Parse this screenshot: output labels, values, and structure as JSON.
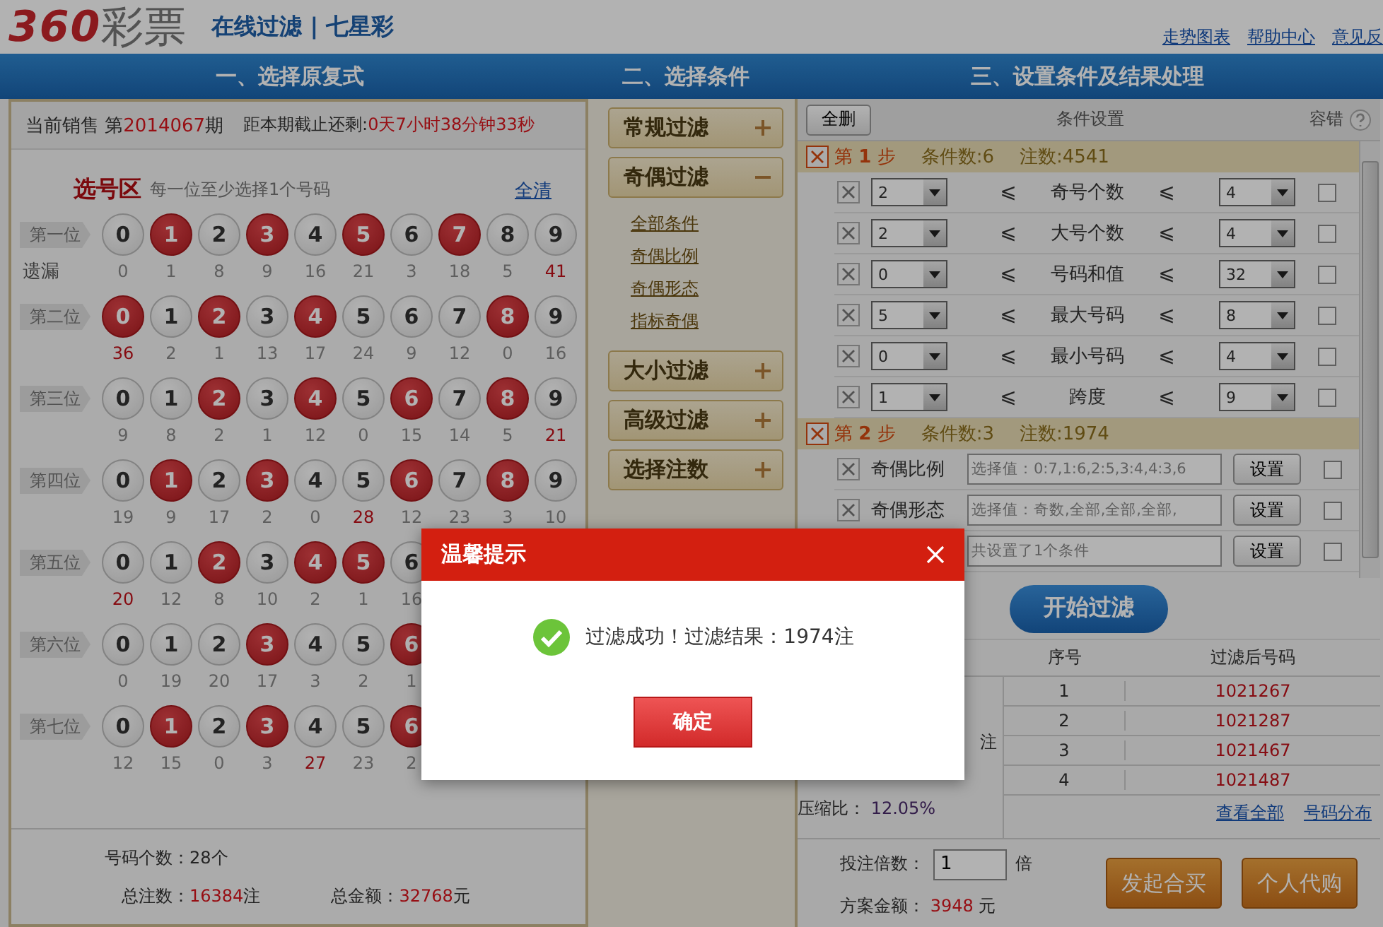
{
  "header": {
    "logo_number": "360",
    "logo_text": "彩票",
    "title": "在线过滤 | 七星彩",
    "links": [
      "走势图表",
      "帮助中心",
      "意见反"
    ]
  },
  "steps": [
    "一、选择原复式",
    "二、选择条件",
    "三、设置条件及结果处理"
  ],
  "draw": {
    "label": "当前销售",
    "issue_prefix": "第",
    "issue": "2014067",
    "issue_suffix": "期",
    "countdown_label": "距本期截止还剩:",
    "countdown": "0天7小时38分钟33秒"
  },
  "picker": {
    "title": "选号区",
    "hint": "每一位至少选择1个号码",
    "clear": "全清",
    "missing_label": "遗漏",
    "positions": [
      {
        "label": "第一位",
        "balls": [
          {
            "n": "0",
            "selected": false,
            "missing": "0",
            "hot": false
          },
          {
            "n": "1",
            "selected": true,
            "missing": "1",
            "hot": false
          },
          {
            "n": "2",
            "selected": false,
            "missing": "8",
            "hot": false
          },
          {
            "n": "3",
            "selected": true,
            "missing": "9",
            "hot": false
          },
          {
            "n": "4",
            "selected": false,
            "missing": "16",
            "hot": false
          },
          {
            "n": "5",
            "selected": true,
            "missing": "21",
            "hot": false
          },
          {
            "n": "6",
            "selected": false,
            "missing": "3",
            "hot": false
          },
          {
            "n": "7",
            "selected": true,
            "missing": "18",
            "hot": false
          },
          {
            "n": "8",
            "selected": false,
            "missing": "5",
            "hot": false
          },
          {
            "n": "9",
            "selected": false,
            "missing": "41",
            "hot": true
          }
        ]
      },
      {
        "label": "第二位",
        "balls": [
          {
            "n": "0",
            "selected": true,
            "missing": "36",
            "hot": true
          },
          {
            "n": "1",
            "selected": false,
            "missing": "2",
            "hot": false
          },
          {
            "n": "2",
            "selected": true,
            "missing": "1",
            "hot": false
          },
          {
            "n": "3",
            "selected": false,
            "missing": "13",
            "hot": false
          },
          {
            "n": "4",
            "selected": true,
            "missing": "17",
            "hot": false
          },
          {
            "n": "5",
            "selected": false,
            "missing": "24",
            "hot": false
          },
          {
            "n": "6",
            "selected": false,
            "missing": "9",
            "hot": false
          },
          {
            "n": "7",
            "selected": false,
            "missing": "12",
            "hot": false
          },
          {
            "n": "8",
            "selected": true,
            "missing": "0",
            "hot": false
          },
          {
            "n": "9",
            "selected": false,
            "missing": "16",
            "hot": false
          }
        ]
      },
      {
        "label": "第三位",
        "balls": [
          {
            "n": "0",
            "selected": false,
            "missing": "9",
            "hot": false
          },
          {
            "n": "1",
            "selected": false,
            "missing": "8",
            "hot": false
          },
          {
            "n": "2",
            "selected": true,
            "missing": "2",
            "hot": false
          },
          {
            "n": "3",
            "selected": false,
            "missing": "1",
            "hot": false
          },
          {
            "n": "4",
            "selected": true,
            "missing": "12",
            "hot": false
          },
          {
            "n": "5",
            "selected": false,
            "missing": "0",
            "hot": false
          },
          {
            "n": "6",
            "selected": true,
            "missing": "15",
            "hot": false
          },
          {
            "n": "7",
            "selected": false,
            "missing": "14",
            "hot": false
          },
          {
            "n": "8",
            "selected": true,
            "missing": "5",
            "hot": false
          },
          {
            "n": "9",
            "selected": false,
            "missing": "21",
            "hot": true
          }
        ]
      },
      {
        "label": "第四位",
        "balls": [
          {
            "n": "0",
            "selected": false,
            "missing": "19",
            "hot": false
          },
          {
            "n": "1",
            "selected": true,
            "missing": "9",
            "hot": false
          },
          {
            "n": "2",
            "selected": false,
            "missing": "17",
            "hot": false
          },
          {
            "n": "3",
            "selected": true,
            "missing": "2",
            "hot": false
          },
          {
            "n": "4",
            "selected": false,
            "missing": "0",
            "hot": false
          },
          {
            "n": "5",
            "selected": false,
            "missing": "28",
            "hot": true
          },
          {
            "n": "6",
            "selected": true,
            "missing": "12",
            "hot": false
          },
          {
            "n": "7",
            "selected": false,
            "missing": "23",
            "hot": false
          },
          {
            "n": "8",
            "selected": true,
            "missing": "3",
            "hot": false
          },
          {
            "n": "9",
            "selected": false,
            "missing": "10",
            "hot": false
          }
        ]
      },
      {
        "label": "第五位",
        "balls": [
          {
            "n": "0",
            "selected": false,
            "missing": "20",
            "hot": true
          },
          {
            "n": "1",
            "selected": false,
            "missing": "12",
            "hot": false
          },
          {
            "n": "2",
            "selected": true,
            "missing": "8",
            "hot": false
          },
          {
            "n": "3",
            "selected": false,
            "missing": "10",
            "hot": false
          },
          {
            "n": "4",
            "selected": true,
            "missing": "2",
            "hot": false
          },
          {
            "n": "5",
            "selected": true,
            "missing": "1",
            "hot": false
          },
          {
            "n": "6",
            "selected": false,
            "missing": "16",
            "hot": false
          }
        ]
      },
      {
        "label": "第六位",
        "balls": [
          {
            "n": "0",
            "selected": false,
            "missing": "0",
            "hot": false
          },
          {
            "n": "1",
            "selected": false,
            "missing": "19",
            "hot": false
          },
          {
            "n": "2",
            "selected": false,
            "missing": "20",
            "hot": false
          },
          {
            "n": "3",
            "selected": true,
            "missing": "17",
            "hot": false
          },
          {
            "n": "4",
            "selected": false,
            "missing": "3",
            "hot": false
          },
          {
            "n": "5",
            "selected": false,
            "missing": "2",
            "hot": false
          },
          {
            "n": "6",
            "selected": true,
            "missing": "1",
            "hot": false
          }
        ]
      },
      {
        "label": "第七位",
        "balls": [
          {
            "n": "0",
            "selected": false,
            "missing": "12",
            "hot": false
          },
          {
            "n": "1",
            "selected": true,
            "missing": "15",
            "hot": false
          },
          {
            "n": "2",
            "selected": false,
            "missing": "0",
            "hot": false
          },
          {
            "n": "3",
            "selected": true,
            "missing": "3",
            "hot": false
          },
          {
            "n": "4",
            "selected": false,
            "missing": "27",
            "hot": true
          },
          {
            "n": "5",
            "selected": false,
            "missing": "23",
            "hot": false
          },
          {
            "n": "6",
            "selected": true,
            "missing": "2",
            "hot": false
          }
        ]
      }
    ]
  },
  "summary": {
    "count_label": "号码个数：",
    "count": "28个",
    "bets_label": "总注数：",
    "bets": "16384",
    "bets_unit": "注",
    "amount_label": "总金额：",
    "amount": "32768",
    "amount_unit": "元"
  },
  "filters": [
    {
      "label": "常规过滤",
      "expanded": false
    },
    {
      "label": "奇偶过滤",
      "expanded": true,
      "children": [
        "全部条件",
        "奇偶比例",
        "奇偶形态",
        "指标奇偶"
      ]
    },
    {
      "label": "大小过滤",
      "expanded": false
    },
    {
      "label": "高级过滤",
      "expanded": false
    },
    {
      "label": "选择注数",
      "expanded": false
    }
  ],
  "conditions": {
    "delete_all": "全删",
    "title": "条件设置",
    "tolerance": "容错",
    "steps": [
      {
        "title": "第 **1** 步",
        "count": "条件数:6",
        "bets": "注数:4541",
        "rows": [
          {
            "kind": "range",
            "min": "2",
            "op_left": "⩽",
            "label": "奇号个数",
            "op_right": "⩽",
            "max": "4",
            "checked": false
          },
          {
            "kind": "range",
            "min": "2",
            "op_left": "⩽",
            "label": "大号个数",
            "op_right": "⩽",
            "max": "4",
            "checked": false
          },
          {
            "kind": "range",
            "min": "0",
            "op_left": "⩽",
            "label": "号码和值",
            "op_right": "⩽",
            "max": "32",
            "checked": false
          },
          {
            "kind": "range",
            "min": "5",
            "op_left": "⩽",
            "label": "最大号码",
            "op_right": "⩽",
            "max": "8",
            "checked": false
          },
          {
            "kind": "range",
            "min": "0",
            "op_left": "⩽",
            "label": "最小号码",
            "op_right": "⩽",
            "max": "4",
            "checked": false
          },
          {
            "kind": "range",
            "min": "1",
            "op_left": "⩽",
            "label": "跨度",
            "op_right": "⩽",
            "max": "9",
            "checked": false
          }
        ]
      },
      {
        "title": "第 **2** 步",
        "count": "条件数:3",
        "bets": "注数:1974",
        "rows": [
          {
            "kind": "field",
            "label": "奇偶比例",
            "value": "选择值：0:7,1:6,2:5,3:4,4:3,6",
            "button": "设置",
            "checked": false
          },
          {
            "kind": "field",
            "label": "奇偶形态",
            "value": "选择值：奇数,全部,全部,全部,",
            "button": "设置",
            "checked": false
          },
          {
            "kind": "field",
            "value": "共设置了1个条件",
            "button": "设置",
            "checked": false
          }
        ]
      }
    ]
  },
  "filter_button": "开始过滤",
  "results": {
    "partial_text": "注",
    "ratio_label": "压缩比：",
    "ratio": "12.05%",
    "columns": [
      "序号",
      "过滤后号码"
    ],
    "rows": [
      [
        "1",
        "1021267"
      ],
      [
        "2",
        "1021287"
      ],
      [
        "3",
        "1021467"
      ],
      [
        "4",
        "1021487"
      ]
    ],
    "links": [
      "查看全部",
      "号码分布"
    ]
  },
  "order": {
    "multiple_label": "投注倍数：",
    "multiple": "1",
    "multiple_unit": "倍",
    "amount_label": "方案金额：",
    "amount": "3948",
    "amount_unit": "元",
    "buttons": [
      "发起合买",
      "个人代购"
    ]
  },
  "dialog": {
    "title": "温馨提示",
    "message": "过滤成功！过滤结果：1974注",
    "button": "确定"
  }
}
